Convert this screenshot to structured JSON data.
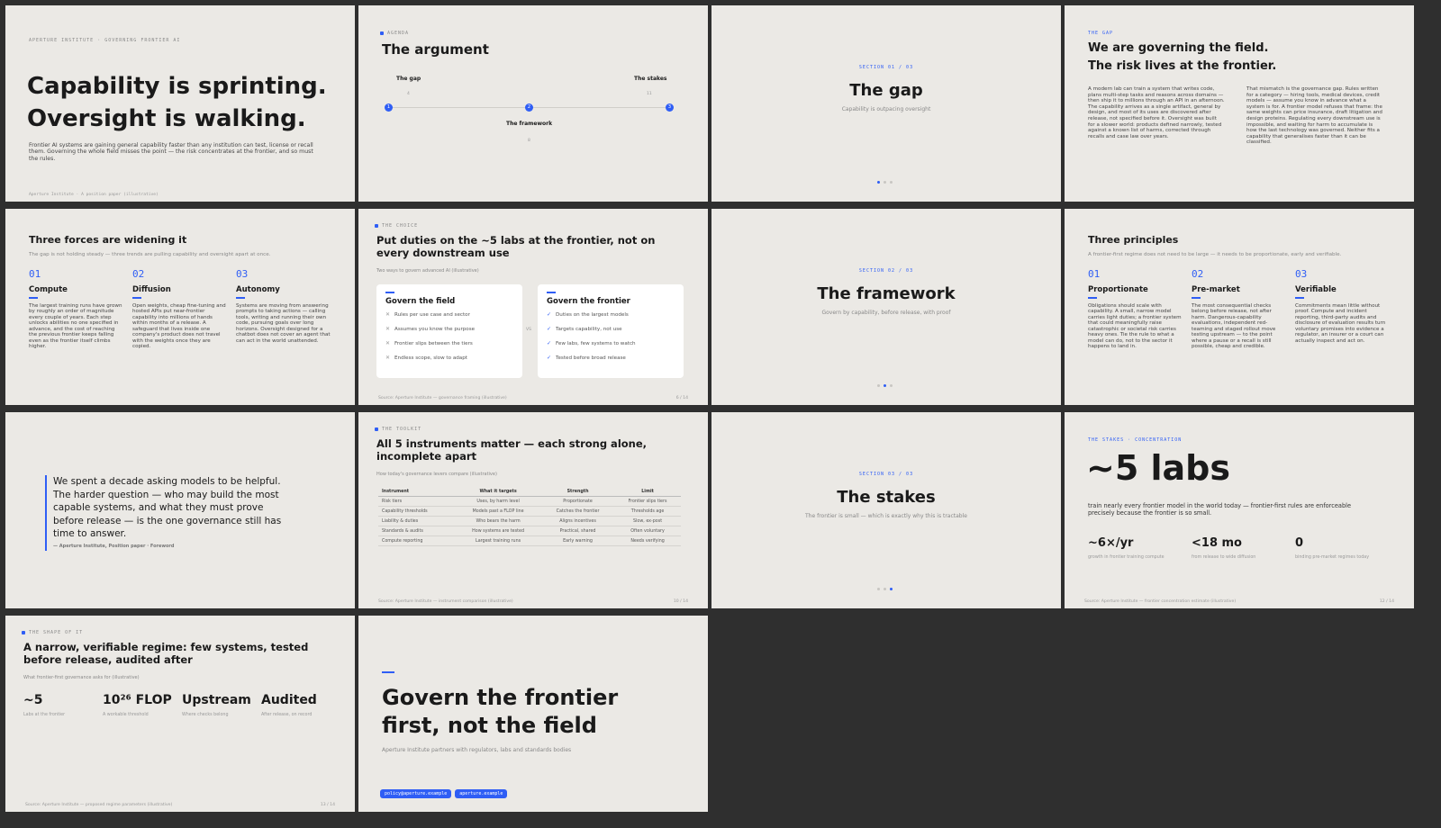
{
  "s1": {
    "kicker": "APERTURE INSTITUTE · GOVERNING FRONTIER AI",
    "title1": "Capability is sprinting.",
    "title2": "Oversight is walking.",
    "body": "Frontier AI systems are gaining general capability faster than any institution can test, license or recall them. Governing the whole field misses the point — the risk concentrates at the frontier, and so must the rules.",
    "footer": "Aperture Institute · A position paper (illustrative)"
  },
  "s2": {
    "kicker": "AGENDA",
    "title": "The argument",
    "n1": "The gap",
    "p1": "4",
    "n2": "The framework",
    "p2": "8",
    "n3": "The stakes",
    "p3": "11",
    "d1": "1",
    "d2": "2",
    "d3": "3"
  },
  "s3": {
    "kicker": "SECTION 01 / 03",
    "title": "The gap",
    "sub": "Capability is outpacing oversight"
  },
  "s4": {
    "kicker": "THE GAP",
    "title1": "We are governing the field.",
    "title2": "The risk lives at the frontier.",
    "col1": "A modern lab can train a system that writes code, plans multi-step tasks and reasons across domains — then ship it to millions through an API in an afternoon. The capability arrives as a single artifact, general by design, and most of its uses are discovered after release, not specified before it. Oversight was built for a slower world: products defined narrowly, tested against a known list of harms, corrected through recalls and case law over years.",
    "col2": "That mismatch is the governance gap. Rules written for a category — hiring tools, medical devices, credit models — assume you know in advance what a system is for. A frontier model refuses that frame: the same weights can price insurance, draft litigation and design proteins. Regulating every downstream use is impossible, and waiting for harm to accumulate is how the last technology was governed. Neither fits a capability that generalises faster than it can be classified."
  },
  "s5": {
    "title": "Three forces are widening it",
    "sub": "The gap is not holding steady — three trends are pulling capability and oversight apart at once.",
    "cols": [
      {
        "n": "01",
        "t": "Compute",
        "b": "The largest training runs have grown by roughly an order of magnitude every couple of years. Each step unlocks abilities no one specified in advance, and the cost of reaching the previous frontier keeps falling even as the frontier itself climbs higher."
      },
      {
        "n": "02",
        "t": "Diffusion",
        "b": "Open weights, cheap fine-tuning and hosted APIs put near-frontier capability into millions of hands within months of a release. A safeguard that lives inside one company's product does not travel with the weights once they are copied."
      },
      {
        "n": "03",
        "t": "Autonomy",
        "b": "Systems are moving from answering prompts to taking actions — calling tools, writing and running their own code, pursuing goals over long horizons. Oversight designed for a chatbot does not cover an agent that can act in the world unattended."
      }
    ]
  },
  "s6": {
    "kicker": "THE CHOICE",
    "title": "Put duties on the ~5 labs at the frontier, not on every downstream use",
    "sub": "Two ways to govern advanced AI (illustrative)",
    "left_title": "Govern the field",
    "left": [
      "Rules per use case and sector",
      "Assumes you know the purpose",
      "Frontier slips between the tiers",
      "Endless scope, slow to adapt"
    ],
    "vs": "VS",
    "right_title": "Govern the frontier",
    "right": [
      "Duties on the largest models",
      "Targets capability, not use",
      "Few labs, few systems to watch",
      "Tested before broad release"
    ],
    "x": "✕",
    "check": "✓",
    "footer": "Source: Aperture Institute — governance framing (illustrative)",
    "page": "6 / 14"
  },
  "s7": {
    "kicker": "SECTION 02 / 03",
    "title": "The framework",
    "sub": "Govern by capability, before release, with proof"
  },
  "s8": {
    "title": "Three principles",
    "sub": "A frontier-first regime does not need to be large — it needs to be proportionate, early and verifiable.",
    "cols": [
      {
        "n": "01",
        "t": "Proportionate",
        "b": "Obligations should scale with capability. A small, narrow model carries light duties; a frontier system that could meaningfully raise catastrophic or societal risk carries heavy ones. Tie the rule to what a model can do, not to the sector it happens to land in."
      },
      {
        "n": "02",
        "t": "Pre-market",
        "b": "The most consequential checks belong before release, not after harm. Dangerous-capability evaluations, independent red-teaming and staged rollout move testing upstream — to the point where a pause or a recall is still possible, cheap and credible."
      },
      {
        "n": "03",
        "t": "Verifiable",
        "b": "Commitments mean little without proof. Compute and incident reporting, third-party audits and disclosure of evaluation results turn voluntary promises into evidence a regulator, an insurer or a court can actually inspect and act on."
      }
    ]
  },
  "s9": {
    "quote": "We spent a decade asking models to be helpful. The harder question — who may build the most capable systems, and what they must prove before release — is the one governance still has time to answer.",
    "attr": "— Aperture Institute,  Position paper · Foreword"
  },
  "s10": {
    "kicker": "THE TOOLKIT",
    "title": "All 5 instruments matter — each strong alone, incomplete apart",
    "sub": "How today's governance levers compare (illustrative)",
    "headers": [
      "Instrument",
      "What it targets",
      "Strength",
      "Limit"
    ],
    "rows": [
      [
        "Risk tiers",
        "Uses, by harm level",
        "Proportionate",
        "Frontier slips tiers"
      ],
      [
        "Capability thresholds",
        "Models past a FLOP line",
        "Catches the frontier",
        "Thresholds age"
      ],
      [
        "Liability & duties",
        "Who bears the harm",
        "Aligns incentives",
        "Slow, ex-post"
      ],
      [
        "Standards & audits",
        "How systems are tested",
        "Practical, shared",
        "Often voluntary"
      ],
      [
        "Compute reporting",
        "Largest training runs",
        "Early warning",
        "Needs verifying"
      ]
    ],
    "footer": "Source: Aperture Institute — instrument comparison (illustrative)",
    "page": "10 / 14"
  },
  "s11": {
    "kicker": "SECTION 03 / 03",
    "title": "The stakes",
    "sub": "The frontier is small — which is exactly why this is tractable"
  },
  "s12": {
    "kicker": "THE STAKES · CONCENTRATION",
    "big": "~5 labs",
    "body": "train nearly every frontier model in the world today — frontier-first rules are enforceable precisely because the frontier is so small.",
    "stats": [
      {
        "v": "~6×/yr",
        "l": "growth in frontier training compute"
      },
      {
        "v": "<18 mo",
        "l": "from release to wide diffusion"
      },
      {
        "v": "0",
        "l": "binding pre-market regimes today"
      }
    ],
    "footer": "Source: Aperture Institute — frontier concentration estimate (illustrative)",
    "page": "12 / 14"
  },
  "s13": {
    "kicker": "THE SHAPE OF IT",
    "title": "A narrow, verifiable regime: few systems, tested before release, audited after",
    "sub": "What frontier-first governance asks for (illustrative)",
    "stats": [
      {
        "v": "~5",
        "l": "Labs at the frontier"
      },
      {
        "v": "10²⁶ FLOP",
        "l": "A workable threshold"
      },
      {
        "v": "Upstream",
        "l": "Where checks belong"
      },
      {
        "v": "Audited",
        "l": "After release, on record"
      }
    ],
    "footer": "Source: Aperture Institute — proposed regime parameters (illustrative)",
    "page": "13 / 14"
  },
  "s14": {
    "title": "Govern the frontier first, not the field",
    "sub": "Aperture Institute partners with regulators, labs and standards bodies",
    "tag1": "policy@aperture.example",
    "tag2": "aperture.example"
  },
  "colors": {
    "accent": "#2f5ef5",
    "slide_bg": "#ebe9e5",
    "canvas_bg": "#2f2f2f"
  }
}
